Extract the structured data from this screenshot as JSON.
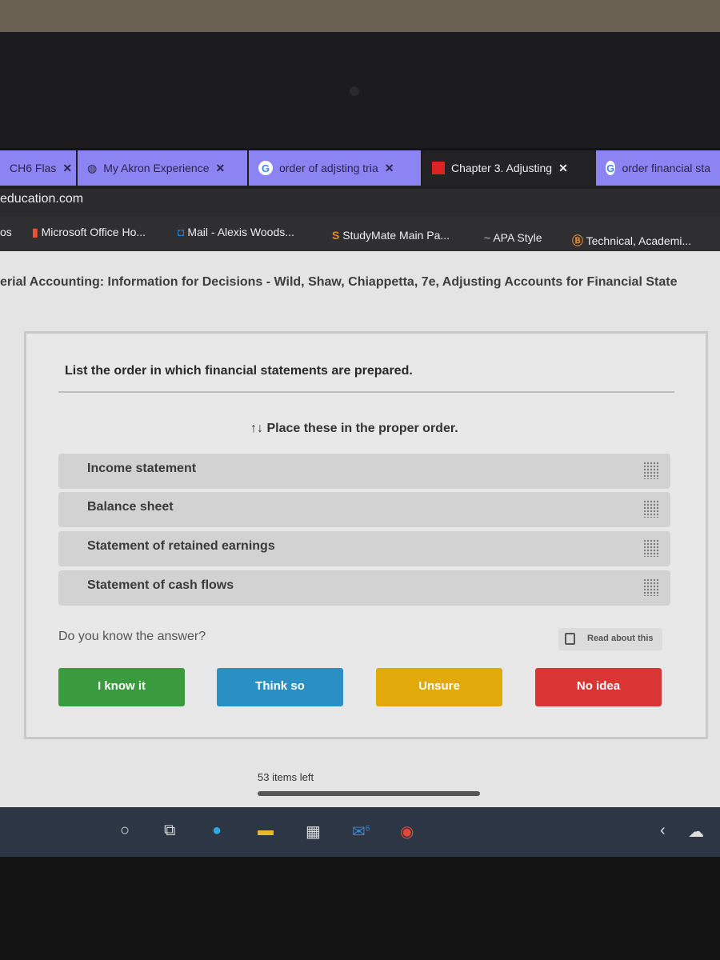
{
  "browser": {
    "tabs": [
      {
        "label": "CH6 Flas",
        "icon": "flashcard-icon"
      },
      {
        "label": "My Akron Experience",
        "icon": "globe-icon"
      },
      {
        "label": "order of adjsting tria",
        "icon": "google-icon"
      },
      {
        "label": "Chapter 3. Adjusting",
        "icon": "mcgraw-hill-icon",
        "active": true
      },
      {
        "label": "order financial sta",
        "icon": "google-icon"
      }
    ],
    "url": "education.com",
    "bookmarks": [
      {
        "label": "Microsoft Office Ho..."
      },
      {
        "label": "Mail - Alexis Woods..."
      },
      {
        "label": "StudyMate Main Pa..."
      },
      {
        "label": "APA Style"
      },
      {
        "label": "Technical, Academi..."
      }
    ],
    "bookmarks_prefix": "os"
  },
  "page": {
    "breadcrumb": "erial Accounting: Information for Decisions - Wild, Shaw, Chiappetta, 7e, Adjusting Accounts for Financial State",
    "question": "List the order in which financial statements are prepared.",
    "instruction": "Place these in the proper order.",
    "items": [
      "Income statement",
      "Balance sheet",
      "Statement of retained earnings",
      "Statement of cash flows"
    ],
    "prompt": "Do you know the answer?",
    "read_about": "Read about this",
    "buttons": [
      {
        "label": "I know it",
        "color": "#3a9a3e"
      },
      {
        "label": "Think so",
        "color": "#2a8fc2"
      },
      {
        "label": "Unsure",
        "color": "#e2a90a"
      },
      {
        "label": "No idea",
        "color": "#d93535"
      }
    ],
    "items_left": "53 items left"
  },
  "taskbar": {
    "mail_badge": "6"
  }
}
